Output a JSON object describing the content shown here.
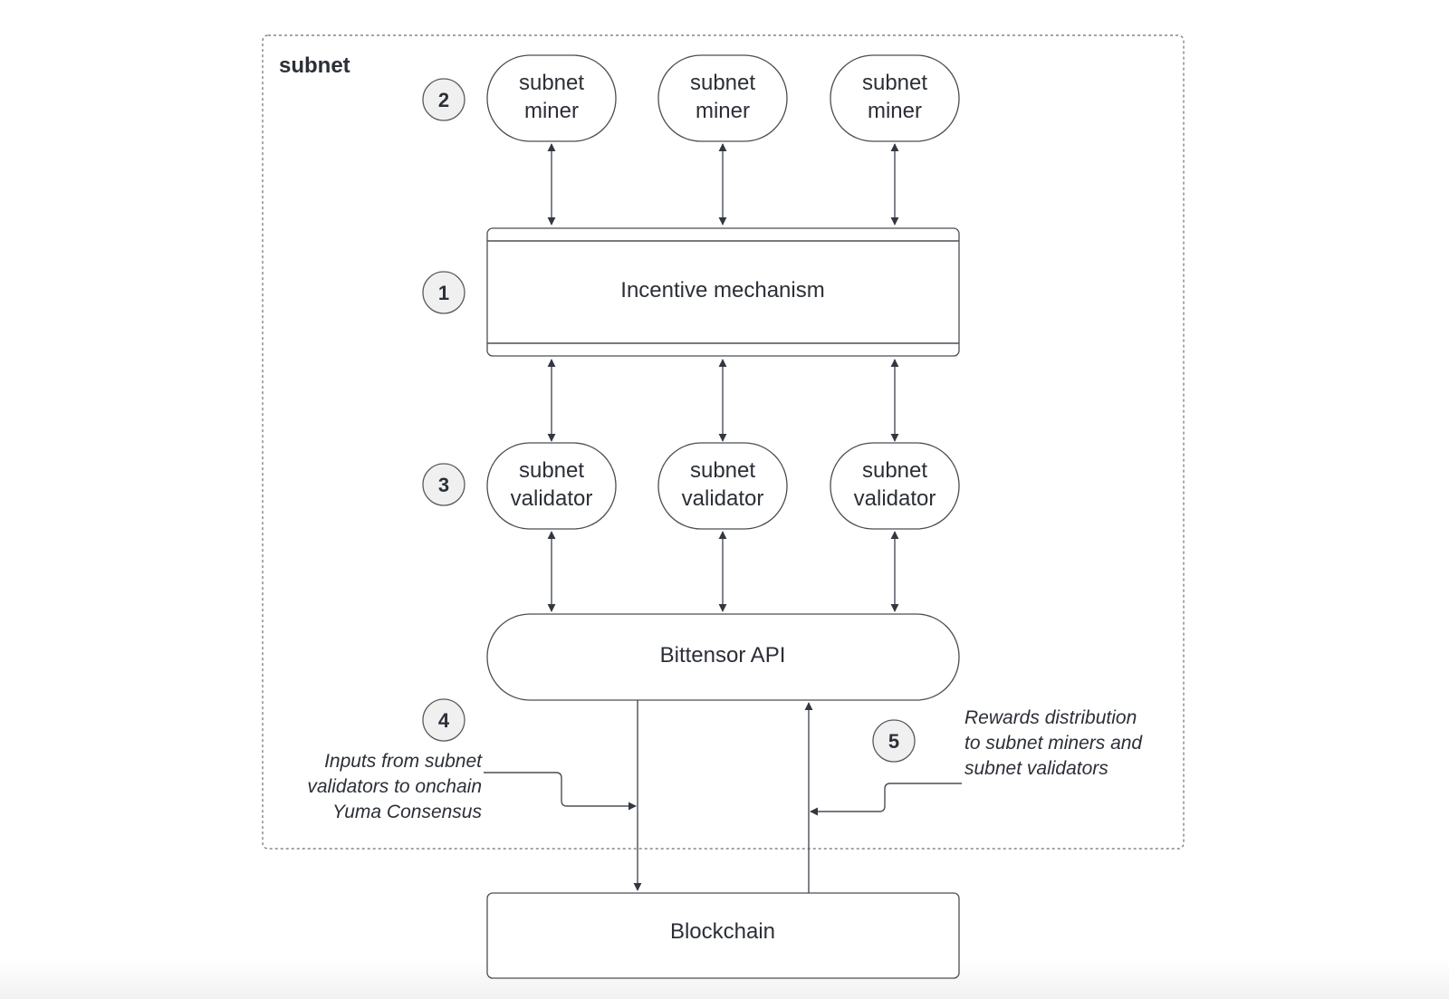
{
  "diagram": {
    "container_label": "subnet",
    "miners": [
      {
        "line1": "subnet",
        "line2": "miner"
      },
      {
        "line1": "subnet",
        "line2": "miner"
      },
      {
        "line1": "subnet",
        "line2": "miner"
      }
    ],
    "incentive_mechanism": "Incentive mechanism",
    "validators": [
      {
        "line1": "subnet",
        "line2": "validator"
      },
      {
        "line1": "subnet",
        "line2": "validator"
      },
      {
        "line1": "subnet",
        "line2": "validator"
      }
    ],
    "bittensor_api": "Bittensor API",
    "blockchain": "Blockchain",
    "badges": [
      "1",
      "2",
      "3",
      "4",
      "5"
    ],
    "notes": {
      "inputs": [
        "Inputs from subnet",
        "validators to onchain",
        "Yuma Consensus"
      ],
      "rewards": [
        "Rewards distribution",
        "to subnet miners and",
        "subnet validators"
      ]
    },
    "colors": {
      "stroke": "#4a4e55",
      "text": "#2b2f36",
      "badge_fill": "#f0f0f0"
    }
  }
}
